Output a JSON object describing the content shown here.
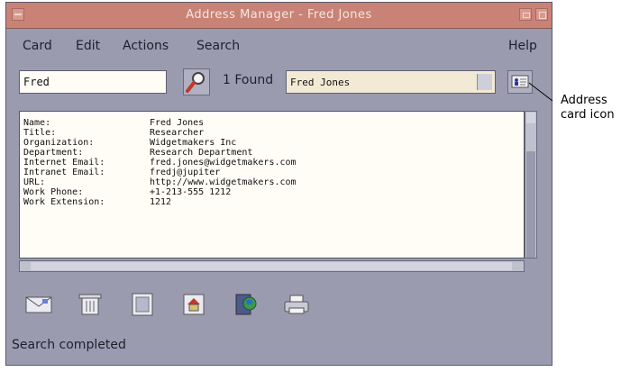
{
  "window": {
    "title": "Address Manager - Fred Jones"
  },
  "menubar": {
    "card": "Card",
    "edit": "Edit",
    "actions": "Actions",
    "search": "Search",
    "help": "Help"
  },
  "search": {
    "value": "Fred",
    "found_label": "1 Found",
    "found_value": "Fred Jones"
  },
  "details": [
    {
      "label": "Name:",
      "value": "Fred Jones"
    },
    {
      "label": "Title:",
      "value": "Researcher"
    },
    {
      "label": "Organization:",
      "value": "Widgetmakers Inc"
    },
    {
      "label": "Department:",
      "value": "Research Department"
    },
    {
      "label": "Internet Email:",
      "value": "fred.jones@widgetmakers.com"
    },
    {
      "label": "Intranet Email:",
      "value": "fredj@jupiter"
    },
    {
      "label": "URL:",
      "value": "http://www.widgetmakers.com"
    },
    {
      "label": "Work Phone:",
      "value": "+1-213-555 1212"
    },
    {
      "label": "Work Extension:",
      "value": "1212"
    }
  ],
  "toolbar_icons": [
    "envelope-icon",
    "delete-icon",
    "document-icon",
    "home-icon",
    "network-icon",
    "print-icon"
  ],
  "status": "Search completed",
  "callout": {
    "line1": "Address",
    "line2": "card icon"
  },
  "colors": {
    "titlebar": "#c98276",
    "window": "#9b9bb0",
    "text_area": "#fffdf6"
  }
}
